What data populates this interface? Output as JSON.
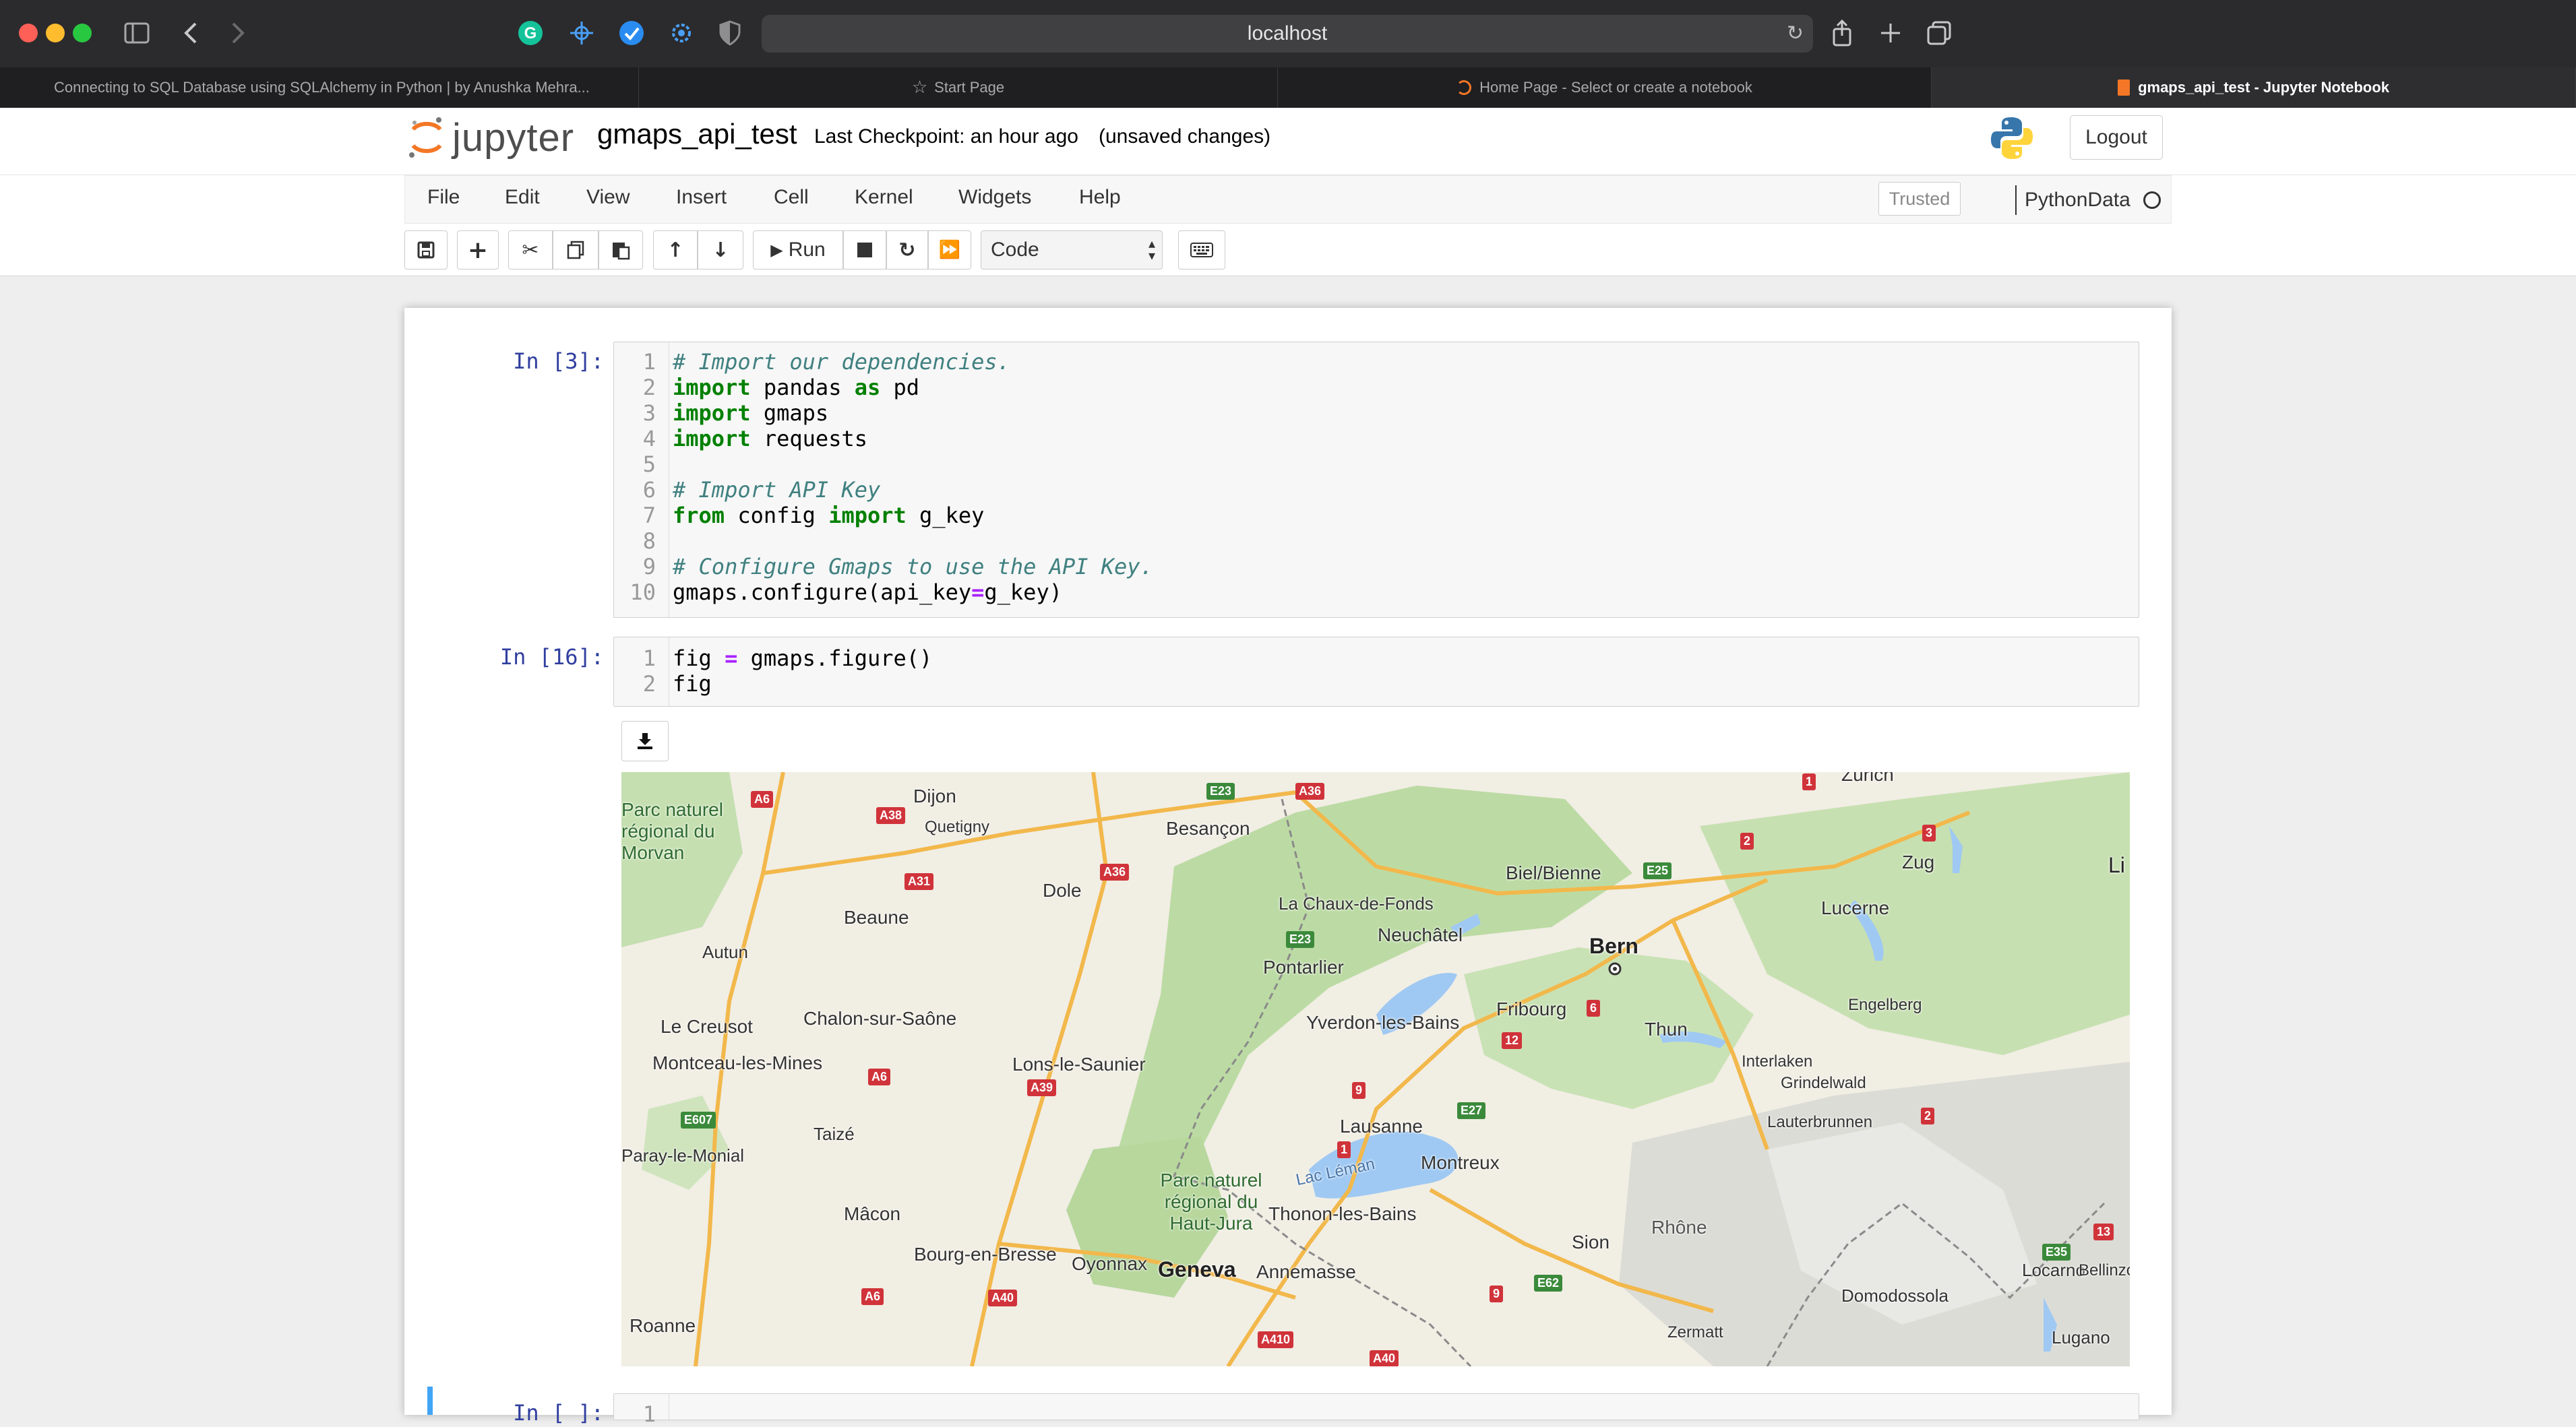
{
  "browser": {
    "url": "localhost",
    "tabs": [
      {
        "label": "Connecting to SQL Database using SQLAlchemy in Python | by Anushka Mehra...",
        "active": false
      },
      {
        "label": "Start Page",
        "active": false
      },
      {
        "label": "Home Page - Select or create a notebook",
        "active": false
      },
      {
        "label": "gmaps_api_test - Jupyter Notebook",
        "active": true
      }
    ]
  },
  "header": {
    "logo_text": "jupyter",
    "notebook_name": "gmaps_api_test",
    "checkpoint": "Last Checkpoint: an hour ago",
    "unsaved": "(unsaved changes)",
    "logout_label": "Logout"
  },
  "menu": {
    "items": [
      "File",
      "Edit",
      "View",
      "Insert",
      "Cell",
      "Kernel",
      "Widgets",
      "Help"
    ],
    "trusted": "Trusted",
    "kernel": "PythonData"
  },
  "toolbar": {
    "run_label": "Run",
    "cell_type": "Code"
  },
  "cells": [
    {
      "prompt": "In [3]:",
      "line_numbers": [
        "1",
        "2",
        "3",
        "4",
        "5",
        "6",
        "7",
        "8",
        "9",
        "10"
      ]
    },
    {
      "prompt": "In [16]:",
      "line_numbers": [
        "1",
        "2"
      ]
    },
    {
      "prompt": "In [ ]:",
      "line_numbers": [
        "1"
      ]
    }
  ],
  "code": {
    "c1_l1": "# Import our dependencies.",
    "c1_l2_kw": "import",
    "c1_l2_a": " pandas ",
    "c1_l2_kw2": "as",
    "c1_l2_b": " pd",
    "c1_l3_kw": "import",
    "c1_l3_a": " gmaps",
    "c1_l4_kw": "import",
    "c1_l4_a": " requests",
    "c1_l6": "# Import API Key",
    "c1_l7_kw": "from",
    "c1_l7_a": " config ",
    "c1_l7_kw2": "import",
    "c1_l7_b": " g_key",
    "c1_l9": "# Configure Gmaps to use the API Key.",
    "c1_l10_a": "gmaps.configure(api_key",
    "c1_l10_op": "=",
    "c1_l10_b": "g_key)",
    "c2_l1_a": "fig ",
    "c2_l1_op": "=",
    "c2_l1_b": " gmaps.figure()",
    "c2_l2": "fig"
  },
  "map": {
    "cities": {
      "zurich": "Zürich",
      "dijon": "Dijon",
      "quetigny": "Quetigny",
      "besancon": "Besançon",
      "parc_morvan": "Parc naturel régional du Morvan",
      "beaune": "Beaune",
      "dole": "Dole",
      "chaux": "La Chaux-de-Fonds",
      "biel": "Biel/Bienne",
      "zug": "Zug",
      "lucerne": "Lucerne",
      "neuchatel": "Neuchâtel",
      "bern": "Bern",
      "autun": "Autun",
      "pontarlier": "Pontarlier",
      "engelberg": "Engelberg",
      "creusot": "Le Creusot",
      "chalon": "Chalon-sur-Saône",
      "yverdon": "Yverdon-les-Bains",
      "fribourg": "Fribourg",
      "thun": "Thun",
      "interlaken": "Interlaken",
      "grindelwald": "Grindelwald",
      "montceau": "Montceau-les-Mines",
      "lons": "Lons-le-Saunier",
      "lauterbrunnen": "Lauterbrunnen",
      "taize": "Taizé",
      "lausanne": "Lausanne",
      "montreux": "Montreux",
      "paray": "Paray-le-Monial",
      "lac_leman": "Lac Léman",
      "parc_jura": "Parc naturel régional du Haut-Jura",
      "macon": "Mâcon",
      "thonon": "Thonon-les-Bains",
      "rhone": "Rhône",
      "sion": "Sion",
      "locarno": "Locarno",
      "bellinzona": "Bellinzo",
      "bourg": "Bourg-en-Bresse",
      "oyonnax": "Oyonnax",
      "geneva": "Geneva",
      "annemasse": "Annemasse",
      "domodossola": "Domodossola",
      "roanne": "Roanne",
      "zermatt": "Zermatt",
      "lugano": "Lugano",
      "li": "Li"
    },
    "roads": {
      "a6_1": "A6",
      "a38": "A38",
      "e23_1": "E23",
      "a36_1": "A36",
      "a31": "A31",
      "a36_2": "A36",
      "e25": "E25",
      "e23_2": "E23",
      "r6": "6",
      "r12": "12",
      "a6_2": "A6",
      "a39": "A39",
      "r9_1": "9",
      "e27": "E27",
      "e607": "E607",
      "r1": "1",
      "r2_1": "2",
      "r3": "3",
      "r1_b": "1",
      "r2_2": "2",
      "r13": "13",
      "e35": "E35",
      "a6_3": "A6",
      "a40_1": "A40",
      "r9_2": "9",
      "e62": "E62",
      "a410": "A410",
      "a40_2": "A40"
    }
  },
  "colors": {
    "prompt_in": "#303f9f",
    "comment": "#408080",
    "keyword": "#008000",
    "operator": "#aa22ff",
    "selected_cell": "#42a5f5",
    "jupyter_orange": "#f37726"
  }
}
